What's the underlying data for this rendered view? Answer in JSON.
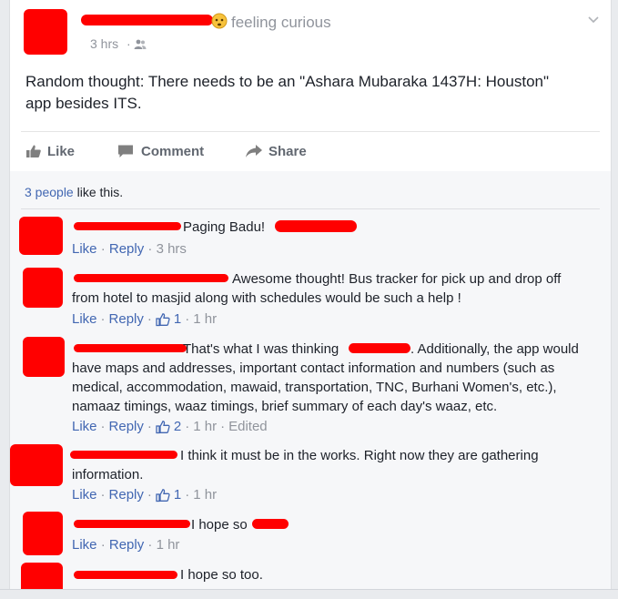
{
  "post": {
    "feeling": "feeling curious",
    "time": "3 hrs",
    "sep": "·",
    "text_line1": "Random thought: There needs to be an \"Ashara Mubaraka 1437H: Houston\"",
    "text_line2": "app besides ITS."
  },
  "actions": {
    "like": "Like",
    "comment": "Comment",
    "share": "Share"
  },
  "likes_summary": {
    "people": "3 people",
    "rest": " like this."
  },
  "comments": [
    {
      "lines": [
        "Paging Badu!"
      ],
      "meta": {
        "like": "Like",
        "reply": "Reply",
        "time": "3 hrs"
      }
    },
    {
      "lines": [
        "Awesome thought! Bus tracker for pick up and drop off",
        "from hotel to masjid along with schedules would be such a help !"
      ],
      "meta": {
        "like": "Like",
        "reply": "Reply",
        "likes": "1",
        "time": "1 hr"
      }
    },
    {
      "line1a": "That's what I was thinking",
      "line1b": ". Additionally, the app would",
      "lines": [
        "have maps and addresses, important contact information and numbers (such as",
        "medical, accommodation, mawaid, transportation, TNC, Burhani Women's, etc.),",
        "namaaz timings, waaz timings, brief summary of each day's waaz, etc."
      ],
      "meta": {
        "like": "Like",
        "reply": "Reply",
        "likes": "2",
        "time": "1 hr",
        "edited": "Edited"
      }
    },
    {
      "lines": [
        "I think it must be in the works. Right now they are gathering",
        "information."
      ],
      "meta": {
        "like": "Like",
        "reply": "Reply",
        "likes": "1",
        "time": "1 hr"
      }
    },
    {
      "lines": [
        "I hope so"
      ],
      "meta": {
        "like": "Like",
        "reply": "Reply",
        "time": "1 hr"
      }
    },
    {
      "lines": [
        "I hope so too."
      ]
    }
  ],
  "colors": {
    "link": "#4267b2",
    "redaction": "#ff0000",
    "meta": "#90949c"
  },
  "icons": [
    "emoji-curious-icon",
    "friends-privacy-icon",
    "chevron-down-icon",
    "thumbs-up-icon",
    "comment-icon",
    "share-arrow-icon",
    "like-count-icon"
  ]
}
